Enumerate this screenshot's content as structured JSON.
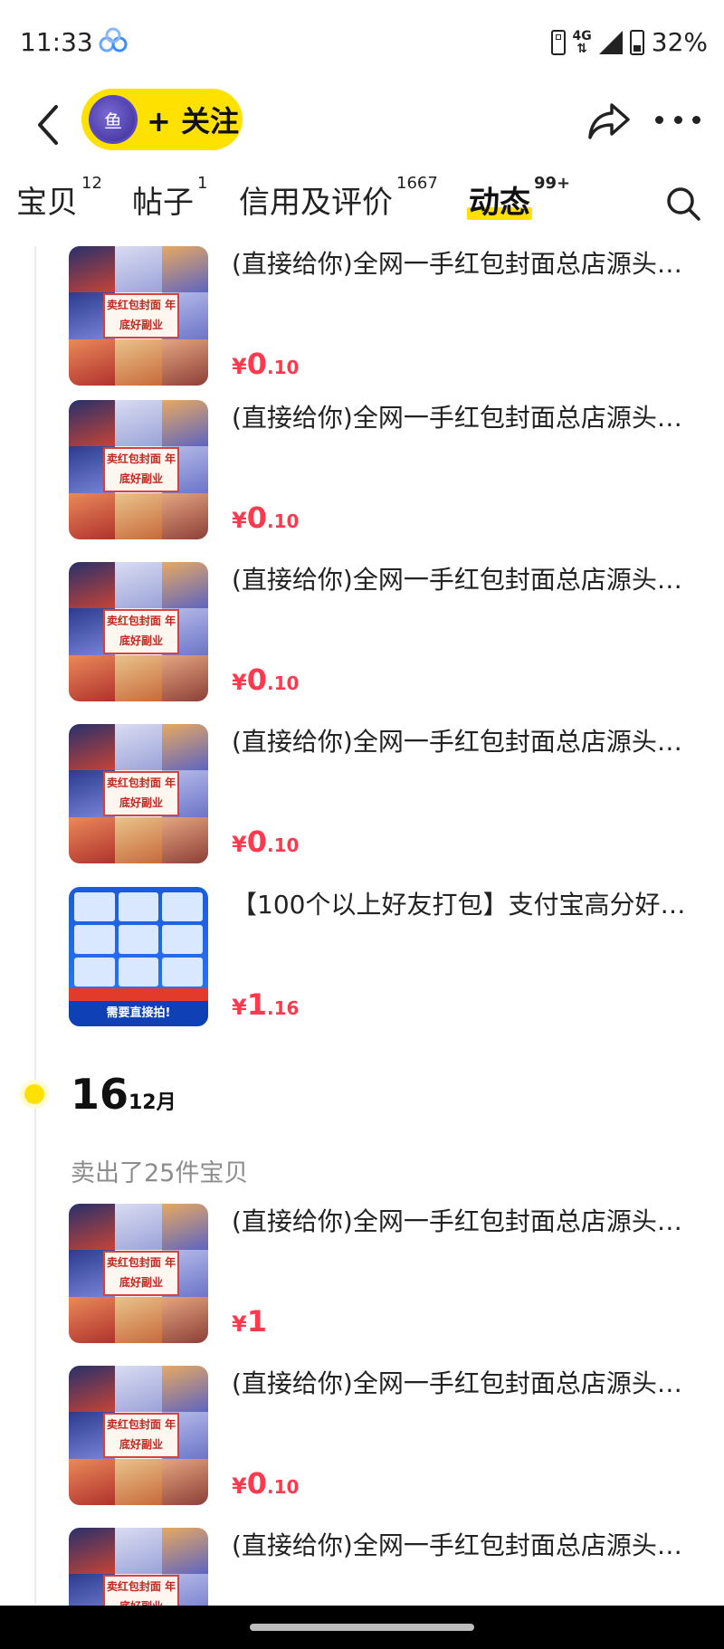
{
  "status_bar": {
    "time": "11:33",
    "network": "4G",
    "battery": "32%"
  },
  "header": {
    "follow_label": "+ 关注",
    "avatar_text": "鱼"
  },
  "tabs": [
    {
      "label": "宝贝",
      "count": "12"
    },
    {
      "label": "帖子",
      "count": "1"
    },
    {
      "label": "信用及评价",
      "count": "1667"
    },
    {
      "label": "动态",
      "count": "99+",
      "active": true
    }
  ],
  "feed": {
    "items_top": [
      {
        "title": "(直接给你)全网一手红包封面总店源头…",
        "price": {
          "yen": "¥",
          "int": "0",
          "dec": ".10"
        },
        "banner": "卖红包封面 年底好副业"
      },
      {
        "title": "(直接给你)全网一手红包封面总店源头…",
        "price": {
          "yen": "¥",
          "int": "0",
          "dec": ".10"
        },
        "banner": "卖红包封面 年底好副业"
      },
      {
        "title": "(直接给你)全网一手红包封面总店源头…",
        "price": {
          "yen": "¥",
          "int": "0",
          "dec": ".10"
        },
        "banner": "卖红包封面 年底好副业"
      },
      {
        "title": "(直接给你)全网一手红包封面总店源头…",
        "price": {
          "yen": "¥",
          "int": "0",
          "dec": ".10"
        },
        "banner": "卖红包封面 年底好副业"
      },
      {
        "title": "【100个以上好友打包】支付宝高分好…",
        "price": {
          "yen": "¥",
          "int": "1",
          "dec": ".16"
        },
        "banner": "需要直接拍!"
      }
    ],
    "date_group": {
      "day": "16",
      "month": "12月",
      "summary": "卖出了25件宝贝"
    },
    "items_bottom": [
      {
        "title": "(直接给你)全网一手红包封面总店源头…",
        "price": {
          "yen": "¥",
          "int": "1",
          "dec": ""
        },
        "banner": "卖红包封面 年底好副业"
      },
      {
        "title": "(直接给你)全网一手红包封面总店源头…",
        "price": {
          "yen": "¥",
          "int": "0",
          "dec": ".10"
        },
        "banner": "卖红包封面 年底好副业"
      },
      {
        "title": "(直接给你)全网一手红包封面总店源头…",
        "price": {
          "yen": "",
          "int": "",
          "dec": ""
        },
        "banner": "卖红包封面 年底好副业"
      }
    ]
  },
  "colors": {
    "accent_yellow": "#FFE100",
    "price_red": "#FF3A4F",
    "muted_text": "#8c8c8c"
  }
}
